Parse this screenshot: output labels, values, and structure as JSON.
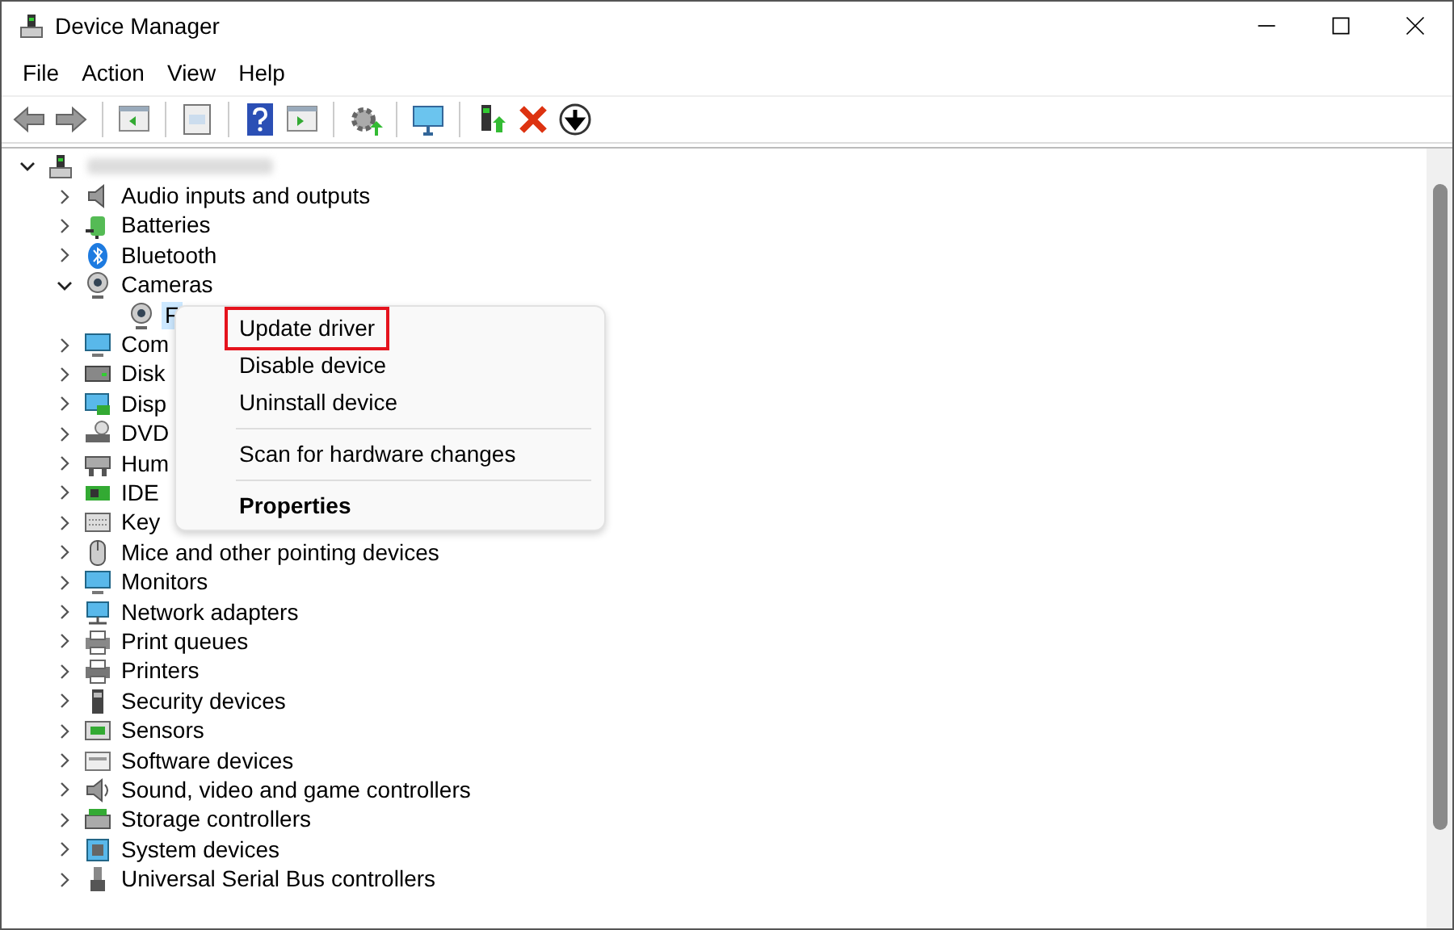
{
  "window": {
    "title": "Device Manager"
  },
  "menu_bar": [
    "File",
    "Action",
    "View",
    "Help"
  ],
  "tree": {
    "expanded": true,
    "children": [
      {
        "label": "Audio inputs and outputs",
        "expanded": false,
        "selected": false
      },
      {
        "label": "Batteries",
        "expanded": false,
        "selected": false
      },
      {
        "label": "Bluetooth",
        "expanded": false,
        "selected": false
      },
      {
        "label": "Cameras",
        "expanded": true,
        "selected": false,
        "children": [
          {
            "label": "F",
            "selected": true
          }
        ]
      },
      {
        "label": "Com",
        "expanded": false,
        "selected": false
      },
      {
        "label": "Disk",
        "expanded": false,
        "selected": false
      },
      {
        "label": "Disp",
        "expanded": false,
        "selected": false
      },
      {
        "label": "DVD",
        "expanded": false,
        "selected": false
      },
      {
        "label": "Hum",
        "expanded": false,
        "selected": false
      },
      {
        "label": "IDE",
        "expanded": false,
        "selected": false
      },
      {
        "label": "Key",
        "expanded": false,
        "selected": false
      },
      {
        "label": "Mice and other pointing devices",
        "expanded": false,
        "selected": false
      },
      {
        "label": "Monitors",
        "expanded": false,
        "selected": false
      },
      {
        "label": "Network adapters",
        "expanded": false,
        "selected": false
      },
      {
        "label": "Print queues",
        "expanded": false,
        "selected": false
      },
      {
        "label": "Printers",
        "expanded": false,
        "selected": false
      },
      {
        "label": "Security devices",
        "expanded": false,
        "selected": false
      },
      {
        "label": "Sensors",
        "expanded": false,
        "selected": false
      },
      {
        "label": "Software devices",
        "expanded": false,
        "selected": false
      },
      {
        "label": "Sound, video and game controllers",
        "expanded": false,
        "selected": false
      },
      {
        "label": "Storage controllers",
        "expanded": false,
        "selected": false
      },
      {
        "label": "System devices",
        "expanded": false,
        "selected": false
      },
      {
        "label": "Universal Serial Bus controllers",
        "expanded": false,
        "selected": false
      }
    ]
  },
  "context_menu": [
    {
      "kind": "item",
      "label": "Update driver",
      "outlined": true
    },
    {
      "kind": "item",
      "label": "Disable device",
      "outlined": false
    },
    {
      "kind": "item",
      "label": "Uninstall device",
      "outlined": false
    },
    {
      "kind": "separator"
    },
    {
      "kind": "item",
      "label": "Scan for hardware changes",
      "outlined": false
    },
    {
      "kind": "separator"
    },
    {
      "kind": "default",
      "label": "Properties",
      "outlined": false
    }
  ]
}
